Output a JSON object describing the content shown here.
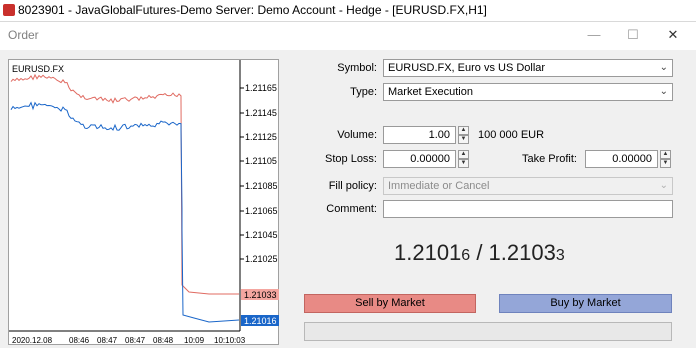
{
  "app": {
    "title": "8023901 - JavaGlobalFutures-Demo Server: Demo Account - Hedge - [EURUSD.FX,H1]"
  },
  "dialog": {
    "title": "Order",
    "minimize": "—",
    "maximize": "☐",
    "close": "✕"
  },
  "chart": {
    "symbol": "EURUSD.FX",
    "price_labels": [
      "1.21165",
      "1.21145",
      "1.21125",
      "1.21105",
      "1.21085",
      "1.21065",
      "1.21045",
      "1.21025"
    ],
    "time_labels": [
      "2020.12.08",
      "08:46",
      "08:47",
      "08:47",
      "08:48",
      "10:09",
      "10:10:03"
    ],
    "ask_tag": "1.21033",
    "bid_tag": "1.21016",
    "colors": {
      "ask": "#e06b62",
      "bid": "#1a66c9",
      "ask_tag_bg": "#f4a6a0",
      "bid_tag_bg": "#1a66c9"
    }
  },
  "form": {
    "symbol_label": "Symbol:",
    "symbol_value": "EURUSD.FX, Euro vs US Dollar",
    "type_label": "Type:",
    "type_value": "Market Execution",
    "volume_label": "Volume:",
    "volume_value": "1.00",
    "volume_note": "100 000 EUR",
    "stoploss_label": "Stop Loss:",
    "stoploss_value": "0.00000",
    "takeprofit_label": "Take Profit:",
    "takeprofit_value": "0.00000",
    "fill_label": "Fill policy:",
    "fill_value": "Immediate or Cancel",
    "comment_label": "Comment:",
    "comment_value": ""
  },
  "quote": {
    "bid_main": "1.2101",
    "bid_last": "6",
    "separator": " / ",
    "ask_main": "1.2103",
    "ask_last": "3"
  },
  "buttons": {
    "sell": "Sell by Market",
    "buy": "Buy by Market",
    "bottom": ""
  }
}
